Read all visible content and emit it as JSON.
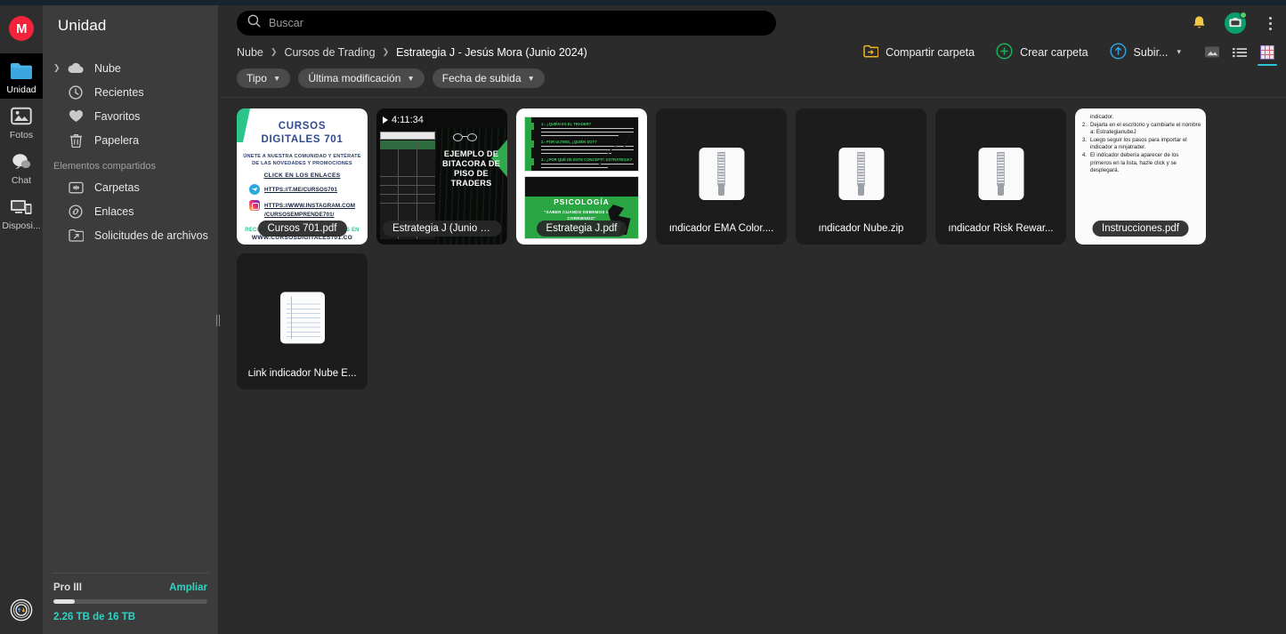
{
  "rail": {
    "logo": "M",
    "items": [
      {
        "label": "Unidad",
        "icon": "folder-icon",
        "active": true
      },
      {
        "label": "Fotos",
        "icon": "photos-icon",
        "active": false
      },
      {
        "label": "Chat",
        "icon": "chat-icon",
        "active": false
      },
      {
        "label": "Disposi...",
        "icon": "devices-icon",
        "active": false
      }
    ],
    "bottom_icon": "transfers-icon"
  },
  "sidebar": {
    "title": "Unidad",
    "items": [
      {
        "label": "Nube",
        "icon": "cloud-icon",
        "has_caret": true
      },
      {
        "label": "Recientes",
        "icon": "clock-icon",
        "has_caret": false
      },
      {
        "label": "Favoritos",
        "icon": "heart-icon",
        "has_caret": false
      },
      {
        "label": "Papelera",
        "icon": "trash-icon",
        "has_caret": false
      }
    ],
    "section_label": "Elementos compartidos",
    "shared_items": [
      {
        "label": "Carpetas",
        "icon": "shared-folders-icon"
      },
      {
        "label": "Enlaces",
        "icon": "link-icon"
      },
      {
        "label": "Solicitudes de archivos",
        "icon": "file-request-icon"
      }
    ],
    "plan": {
      "name": "Pro III",
      "upgrade_label": "Ampliar",
      "usage_text": "2.26 TB de 16 TB",
      "used_percent": 14,
      "accent_color": "#2cd5c4"
    }
  },
  "search": {
    "placeholder": "Buscar",
    "value": "",
    "icon": "search-icon"
  },
  "topbar": {
    "notifications_icon": "bell-icon",
    "avatar_icon": "user-avatar",
    "menu_icon": "kebab-menu-icon"
  },
  "breadcrumb": [
    {
      "label": "Nube"
    },
    {
      "label": "Cursos de Trading"
    },
    {
      "label": "Estrategia J - Jesús Mora (Junio 2024)"
    }
  ],
  "actions": [
    {
      "label": "Compartir carpeta",
      "icon": "share-folder-icon"
    },
    {
      "label": "Crear carpeta",
      "icon": "plus-circle-icon"
    },
    {
      "label": "Subir...",
      "icon": "upload-circle-icon",
      "has_caret": true
    }
  ],
  "view_modes": [
    {
      "name": "media-view",
      "active": false
    },
    {
      "name": "list-view",
      "active": false
    },
    {
      "name": "grid-view",
      "active": true
    }
  ],
  "filters": [
    {
      "label": "Tipo"
    },
    {
      "label": "Última modificación"
    },
    {
      "label": "Fecha de subida"
    }
  ],
  "files": [
    {
      "name": "Cursos 701.pdf",
      "type": "pdf-thumbnail",
      "thumb": {
        "title_line1": "CURSOS",
        "title_line2": "DIGITALES 701",
        "subtitle": "ÚNETE A NUESTRA COMUNIDAD Y ENTÉRATE DE LAS NOVEDADES Y PROMOCIONES",
        "cta": "CLICK EN LOS ENLACES",
        "link_telegram": "HTTPS://T.ME/CURSOS701",
        "link_instagram_1": "HTTPS://WWW.INSTAGRAM.COM",
        "link_instagram_2": "/CURSOSEMPRENDE701/",
        "footer_green": "RECUERDA VER TODOS LOS CURSOS EN",
        "footer_dark": "WWW.CURSOSDIGITALES701.CO"
      }
    },
    {
      "name": "Estrategia J (Junio 20...",
      "type": "video-thumbnail",
      "duration": "4:11:34",
      "thumb": {
        "title": "EJEMPLO DE BITACORA DE PISO DE TRADERS"
      }
    },
    {
      "name": "Estrategia J.pdf",
      "type": "pdf-thumbnail-2",
      "thumb": {
        "heading": "PSICOLOGÍA",
        "quote": "\"SABER CUANDO DEBEMOS SALIR CORRIENDO\""
      }
    },
    {
      "name": "Indicador EMA Color....",
      "type": "zip"
    },
    {
      "name": "Indicador Nube.zip",
      "type": "zip"
    },
    {
      "name": "Indicador Risk Rewar...",
      "type": "zip"
    },
    {
      "name": "Instrucciones.pdf",
      "type": "pdf-instructions",
      "thumb": {
        "first_fragment": "indicador.",
        "steps": [
          {
            "num": "2.",
            "text": "Dejarla en el escritorio y cambiarle el nombre a: EstrategianubeJ"
          },
          {
            "num": "3.",
            "text": "Luego seguir los pasos para importar el indicador a ninjatrader."
          },
          {
            "num": "4.",
            "text": "El indicador debería aparecer de los primeros en la lista, hazle click y se desplegará."
          }
        ]
      }
    },
    {
      "name": "Link indicador Nube E...",
      "type": "text-doc"
    }
  ]
}
